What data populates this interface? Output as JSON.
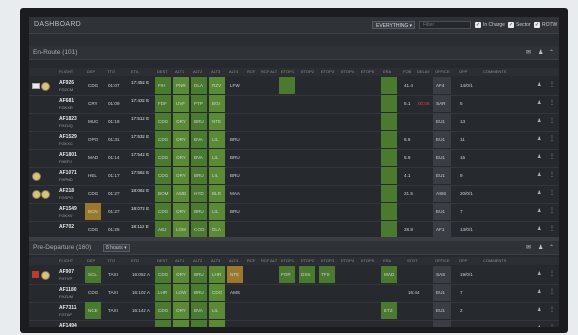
{
  "dashboard": {
    "title": "DASHBOARD"
  },
  "toolbar": {
    "view_select": "EVERYTHING",
    "filter_placeholder": "Filter",
    "in_charge": "In Charge",
    "sector": "Sector",
    "rotw": "ROTW",
    "check": "✓",
    "caret": "▾"
  },
  "enroute": {
    "title": "En-Route",
    "count": "(101)",
    "columns": [
      "FLIGHT",
      "DEP",
      "TTO",
      "ETA",
      "DEST",
      "ALT1",
      "ALT2",
      "ALT3",
      "ALT4",
      "RCF",
      "RCF ALT",
      "ETOP1",
      "ETOP2",
      "ETOP3",
      "ETOP4",
      "ETOP5",
      "ERA",
      "FOB",
      "DELAY",
      "OFFICE",
      "OPP",
      "COMMENTS"
    ],
    "rows": [
      {
        "flight": "AF926",
        "reg": "FGZCM",
        "dep": "CDG",
        "tto": "01:07",
        "eta": "17:45z E",
        "eta2": "",
        "dest": "FIH",
        "alt1": "PNR",
        "alt2": "DLA",
        "alt3": "RZV",
        "alt4": "LFW",
        "fob": "41.4",
        "delay": "",
        "office": "AF4",
        "opp": "14/0/1"
      },
      {
        "flight": "AF681",
        "reg": "FGKXR",
        "dep": "CRY",
        "tto": "01:09",
        "eta": "17:43z E",
        "eta2": "",
        "dest": "FDF",
        "alt1": "UVF",
        "alt2": "PTP",
        "alt3": "BGI",
        "alt4": "",
        "fob": "5.1",
        "delay": "00:05",
        "office": "SAR",
        "opp": "5"
      },
      {
        "flight": "AF1823",
        "reg": "FHZUQ",
        "dep": "MUC",
        "tto": "01:18",
        "eta": "17:51z E",
        "eta2": "",
        "dest": "CDG",
        "alt1": "ORY",
        "alt2": "BRU",
        "alt3": "NTE",
        "alt4": "",
        "fob": "",
        "delay": "",
        "office": "EU1",
        "opp": "13"
      },
      {
        "flight": "AF1529",
        "reg": "FGKXC",
        "dep": "OPO",
        "tto": "01:31",
        "eta": "17:53z E",
        "eta2": "",
        "dest": "CDG",
        "alt1": "ORY",
        "alt2": "BVA",
        "alt3": "LIL",
        "alt4": "BRU",
        "fob": "6.6",
        "delay": "",
        "office": "EU1",
        "opp": "11"
      },
      {
        "flight": "AF1801",
        "reg": "FHEPJ",
        "dep": "MAD",
        "tto": "01:14",
        "eta": "17:54z E",
        "eta2": "",
        "dest": "CDG",
        "alt1": "ORY",
        "alt2": "BVA",
        "alt3": "LIL",
        "alt4": "BRU",
        "fob": "5.9",
        "delay": "",
        "office": "EU1",
        "opp": "15"
      },
      {
        "flight": "AF1071",
        "reg": "FHPND",
        "dep": "HEL",
        "tto": "01:17",
        "eta": "17:56z E",
        "eta2": "",
        "dest": "CDG",
        "alt1": "ORY",
        "alt2": "BRU",
        "alt3": "LIL",
        "alt4": "BRU",
        "fob": "4.1",
        "delay": "",
        "office": "EU1",
        "opp": "9"
      },
      {
        "flight": "AF218",
        "reg": "FGSPG",
        "dep": "CDG",
        "tto": "01:27",
        "eta": "18:06z E",
        "eta2": "",
        "dest": "BOM",
        "alt1": "AMD",
        "alt2": "HYD",
        "alt3": "BLR",
        "alt4": "MAA",
        "fob": "21.5",
        "delay": "",
        "office": "ASI6",
        "opp": "20/0/1"
      },
      {
        "flight": "AF1549",
        "reg": "FGKXV",
        "dep": "BCN",
        "tto": "01:27",
        "eta": "18:07z E",
        "eta2": "",
        "dest": "CDG",
        "alt1": "ORY",
        "alt2": "BRU",
        "alt3": "LIL",
        "alt4": "BRU",
        "fob": "",
        "delay": "",
        "office": "EU1",
        "opp": "7"
      },
      {
        "flight": "AF702",
        "reg": "",
        "dep": "CDG",
        "tto": "01:25",
        "eta": "18:11z E",
        "eta2": "",
        "dest": "ABJ",
        "alt1": "LOM",
        "alt2": "COO",
        "alt3": "DLA",
        "alt4": "",
        "fob": "28.8",
        "delay": "",
        "office": "AF1",
        "opp": "13/0/1"
      }
    ]
  },
  "predeparture": {
    "title": "Pre-Departure",
    "count": "(160)",
    "hours": "8 hours",
    "columns": [
      "FLIGHT",
      "DEP",
      "TTO",
      "ETD",
      "DEST",
      "ALT1",
      "ALT2",
      "ALT3",
      "ALT4",
      "RCF",
      "RCF ALT",
      "ETOP1",
      "ETOP2",
      "ETOP3",
      "ETOP4",
      "ETOP5",
      "ERA",
      "STOT",
      "OFFICE",
      "OPP",
      "COMMENTS"
    ],
    "rows": [
      {
        "flight": "AF907",
        "reg": "FHTVP",
        "dep": "SCL",
        "tto": "TAXI",
        "etd": "16:05z A",
        "dest": "CDG",
        "alt1": "ORY",
        "alt2": "BRU",
        "alt3": "LHR",
        "alt4": "NTE",
        "etop": [
          "FOR",
          "DSS",
          "TFS"
        ],
        "era": "MAD",
        "stot": "",
        "office": "SAS",
        "opp": "19/0/1"
      },
      {
        "flight": "AF1180",
        "reg": "FHZUM",
        "dep": "CDG",
        "tto": "TAXI",
        "etd": "16:10z A",
        "dest": "LHR",
        "alt1": "LOW",
        "alt2": "BRU",
        "alt3": "CDG",
        "alt4": "AMS",
        "etop": [],
        "era": "",
        "stot": "16:44",
        "stot2": "00:03",
        "office": "EU1",
        "opp": "7"
      },
      {
        "flight": "AF7311",
        "reg": "FGTAP",
        "dep": "NCE",
        "tto": "TAXI",
        "etd": "16:14z A",
        "dest": "CDG",
        "alt1": "ORY",
        "alt2": "BVA",
        "alt3": "LIL",
        "alt4": "",
        "etop": [],
        "era": "ETZ",
        "stot": "",
        "office": "EU1",
        "opp": "2"
      },
      {
        "flight": "AF1494",
        "reg": "",
        "dep": "",
        "tto": "",
        "etd": "",
        "dest": "CDG",
        "alt1": "ORY",
        "alt2": "",
        "alt3": "",
        "alt4": "",
        "etop": [],
        "era": "",
        "stot": "",
        "office": "",
        "opp": ""
      }
    ]
  },
  "icons": {
    "envelope": "✉",
    "person": "♟",
    "collapse": "⌃",
    "kebab": "⋮"
  }
}
